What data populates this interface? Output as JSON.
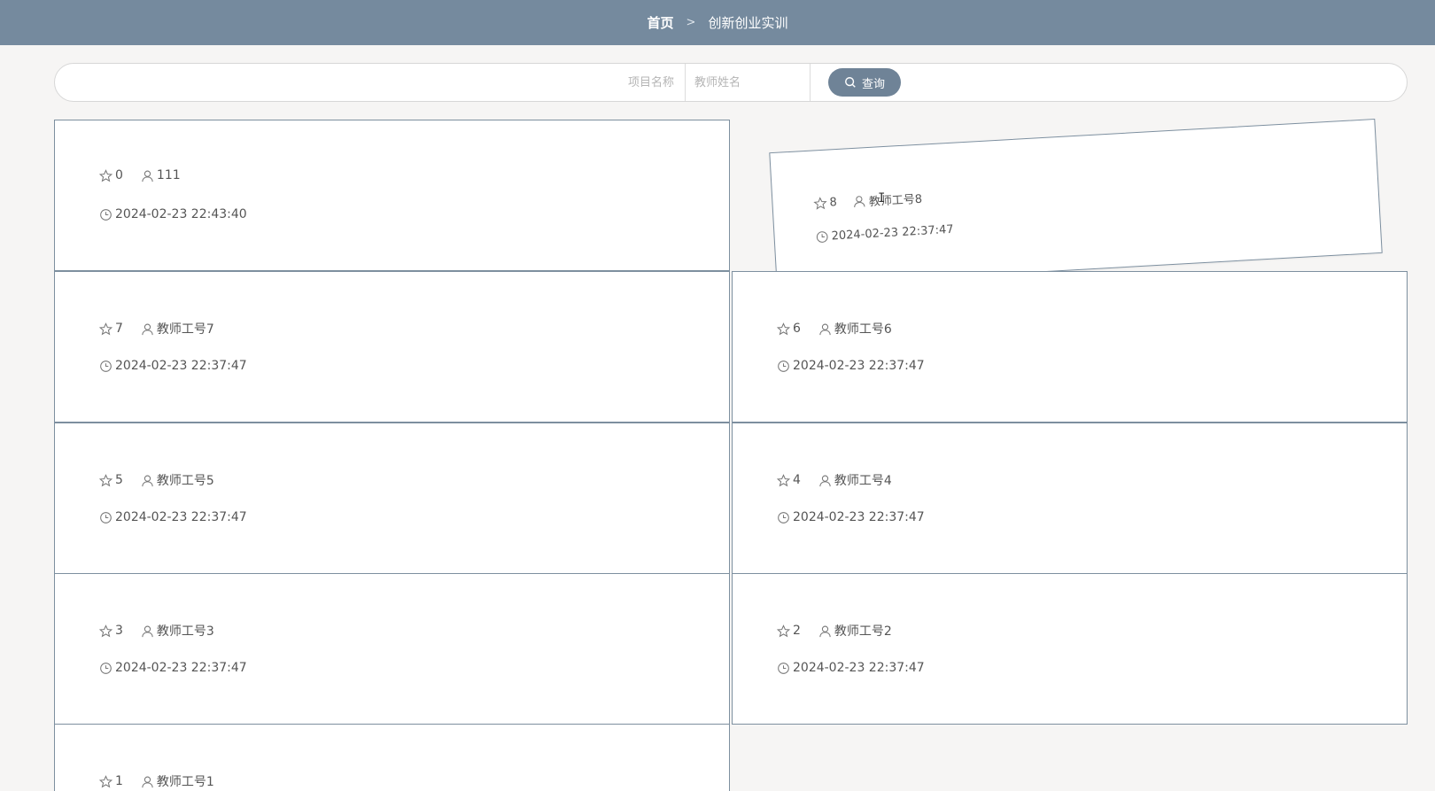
{
  "breadcrumb": {
    "home": "首页",
    "separator": ">",
    "current": "创新创业实训"
  },
  "search": {
    "project_placeholder": "项目名称",
    "teacher_placeholder": "教师姓名",
    "button_label": "查询"
  },
  "cards": [
    {
      "likes": "0",
      "teacher": "111",
      "time": "2024-02-23 22:43:40"
    },
    {
      "likes": "8",
      "teacher": "教师工号8",
      "time": "2024-02-23 22:37:47"
    },
    {
      "likes": "7",
      "teacher": "教师工号7",
      "time": "2024-02-23 22:37:47"
    },
    {
      "likes": "6",
      "teacher": "教师工号6",
      "time": "2024-02-23 22:37:47"
    },
    {
      "likes": "5",
      "teacher": "教师工号5",
      "time": "2024-02-23 22:37:47"
    },
    {
      "likes": "4",
      "teacher": "教师工号4",
      "time": "2024-02-23 22:37:47"
    },
    {
      "likes": "3",
      "teacher": "教师工号3",
      "time": "2024-02-23 22:37:47"
    },
    {
      "likes": "2",
      "teacher": "教师工号2",
      "time": "2024-02-23 22:37:47"
    },
    {
      "likes": "1",
      "teacher": "教师工号1",
      "time": ""
    }
  ],
  "icons": {
    "like": "star-icon",
    "teacher": "user-icon",
    "time": "clock-icon",
    "search": "search-icon"
  },
  "colors": {
    "header": "#758a9e",
    "button": "#6f8397",
    "card_border": "#7d8f9f",
    "background": "#f6f5f4"
  }
}
